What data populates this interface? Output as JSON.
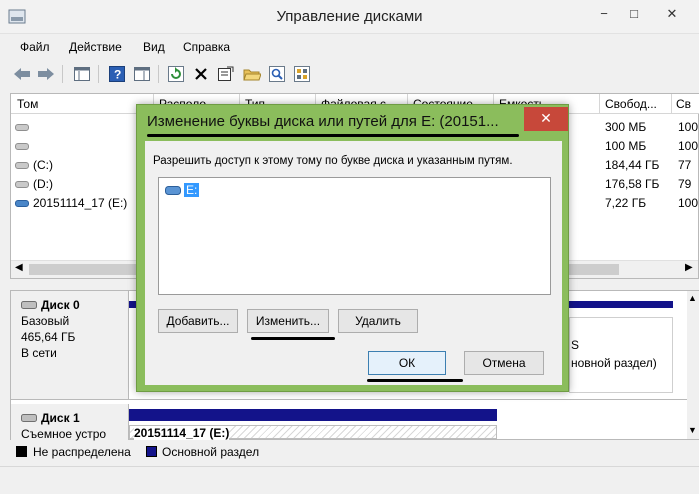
{
  "window": {
    "title": "Управление дисками",
    "controls": [
      "−",
      "□",
      "✕"
    ]
  },
  "menu": [
    "Файл",
    "Действие",
    "Вид",
    "Справка"
  ],
  "toolbar": {
    "icons": [
      "back-arrow-icon",
      "forward-arrow-icon",
      "console-view-icon",
      "help-icon",
      "properties-panel-icon",
      "refresh-icon",
      "delete-icon",
      "properties-icon",
      "open-folder-icon",
      "search-icon",
      "settings-icon"
    ]
  },
  "volume_list": {
    "columns": [
      "Том",
      "Располо",
      "Тип",
      "Файловая с",
      "Состояние",
      "Емкость",
      "Свобод...",
      "Св"
    ],
    "rows": [
      {
        "name": "",
        "free": "300 МБ",
        "pct": "100"
      },
      {
        "name": "",
        "free": "100 МБ",
        "pct": "100"
      },
      {
        "name": "(C:)",
        "free": "184,44 ГБ",
        "pct": "77"
      },
      {
        "name": "(D:)",
        "free": "176,58 ГБ",
        "pct": "79"
      },
      {
        "name": "20151114_17 (E:)",
        "free": "7,22 ГБ",
        "pct": "100"
      }
    ]
  },
  "disks": [
    {
      "title": "Диск 0",
      "type": "Базовый",
      "size": "465,64 ГБ",
      "status": "В сети",
      "partition_fragment": "S",
      "partition_type": "новной раздел)"
    },
    {
      "title": "Диск 1",
      "type": "Съемное устро",
      "partition_label": "20151114_17 (E:)"
    }
  ],
  "legend": {
    "unallocated": "Не распределена",
    "primary": "Основной раздел",
    "colors": {
      "unallocated": "#000000",
      "primary": "#13138a"
    }
  },
  "dialog": {
    "title": "Изменение буквы диска или путей для E: (20151...",
    "close": "✕",
    "description": "Разрешить доступ к этому тому по букве диска и указанным путям.",
    "paths": [
      "E:"
    ],
    "buttons": {
      "add": "Добавить...",
      "change": "Изменить...",
      "remove": "Удалить",
      "ok": "ОК",
      "cancel": "Отмена"
    },
    "accent": "#8bbd5c"
  }
}
